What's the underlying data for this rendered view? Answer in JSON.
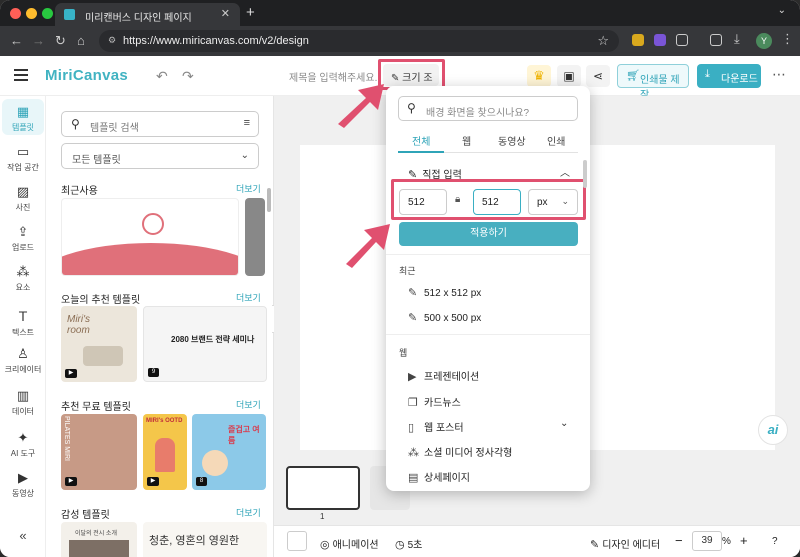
{
  "browser": {
    "tab_title": "미리캔버스 디자인 페이지",
    "url": "https://www.miricanvas.com/v2/design",
    "avatar_letter": "Y"
  },
  "header": {
    "logo": "MiriCanvas",
    "title_placeholder": "제목을 입력해주세요.",
    "size_button": "크기 조정",
    "print_button": "인쇄물 제작",
    "download_button": "다운로드"
  },
  "rail": [
    {
      "label": "템플릿",
      "icon": "template-icon"
    },
    {
      "label": "작업 공간",
      "icon": "folder-icon"
    },
    {
      "label": "사진",
      "icon": "photo-icon"
    },
    {
      "label": "업로드",
      "icon": "upload-icon"
    },
    {
      "label": "요소",
      "icon": "shapes-icon"
    },
    {
      "label": "텍스트",
      "icon": "text-icon"
    },
    {
      "label": "크리에이터",
      "icon": "creator-icon"
    },
    {
      "label": "데이터",
      "icon": "chart-icon"
    },
    {
      "label": "AI 도구",
      "icon": "ai-sparkle-icon"
    },
    {
      "label": "동영상",
      "icon": "video-icon"
    }
  ],
  "panel": {
    "search_placeholder": "템플릿 검색",
    "select_value": "모든 템플릿",
    "sections": [
      {
        "title": "최근사용",
        "more": "더보기"
      },
      {
        "title": "오늘의 추천 템플릿",
        "more": "더보기"
      },
      {
        "title": "추천 무료 템플릿",
        "more": "더보기"
      },
      {
        "title": "감성 템플릿",
        "more": "더보기"
      }
    ],
    "thumb_texts": {
      "miris_room": "Miri's room",
      "seminar": "2080 브랜드 전략 세미나",
      "seminar_page": "9",
      "ootd": "MIRI's OOTD",
      "summer": "즐겁고 여름",
      "summer_page": "8",
      "pilates": "PILATES MIRI",
      "sensitive1": "이달의 전시 소개",
      "sensitive2": "청춘, 영혼의 영원한"
    }
  },
  "popup": {
    "search_placeholder": "배경 화면을 찾으시나요?",
    "tabs": [
      "전체",
      "웹",
      "동영상",
      "인쇄"
    ],
    "direct_input": "직접 입력",
    "width": "512",
    "height": "512",
    "unit": "px",
    "apply": "적용하기",
    "recent_label": "최근",
    "recent": [
      "512 x 512 px",
      "500 x 500 px"
    ],
    "web_label": "웹",
    "web_items": [
      {
        "label": "프레젠테이션",
        "icon": "presentation-icon"
      },
      {
        "label": "카드뉴스",
        "icon": "cardnews-icon"
      },
      {
        "label": "웹 포스터",
        "icon": "web-poster-icon"
      },
      {
        "label": "소셜 미디어 정사각형",
        "icon": "social-square-icon"
      },
      {
        "label": "상세페이지",
        "icon": "detail-page-icon"
      }
    ]
  },
  "canvas": {
    "page_number": "1"
  },
  "bottom": {
    "animation": "애니메이션",
    "duration": "5초",
    "design_editor": "디자인 에디터",
    "zoom": "39",
    "zoom_unit": "%"
  },
  "colors": {
    "accent": "#3aafc3",
    "highlight": "#e0506f"
  }
}
